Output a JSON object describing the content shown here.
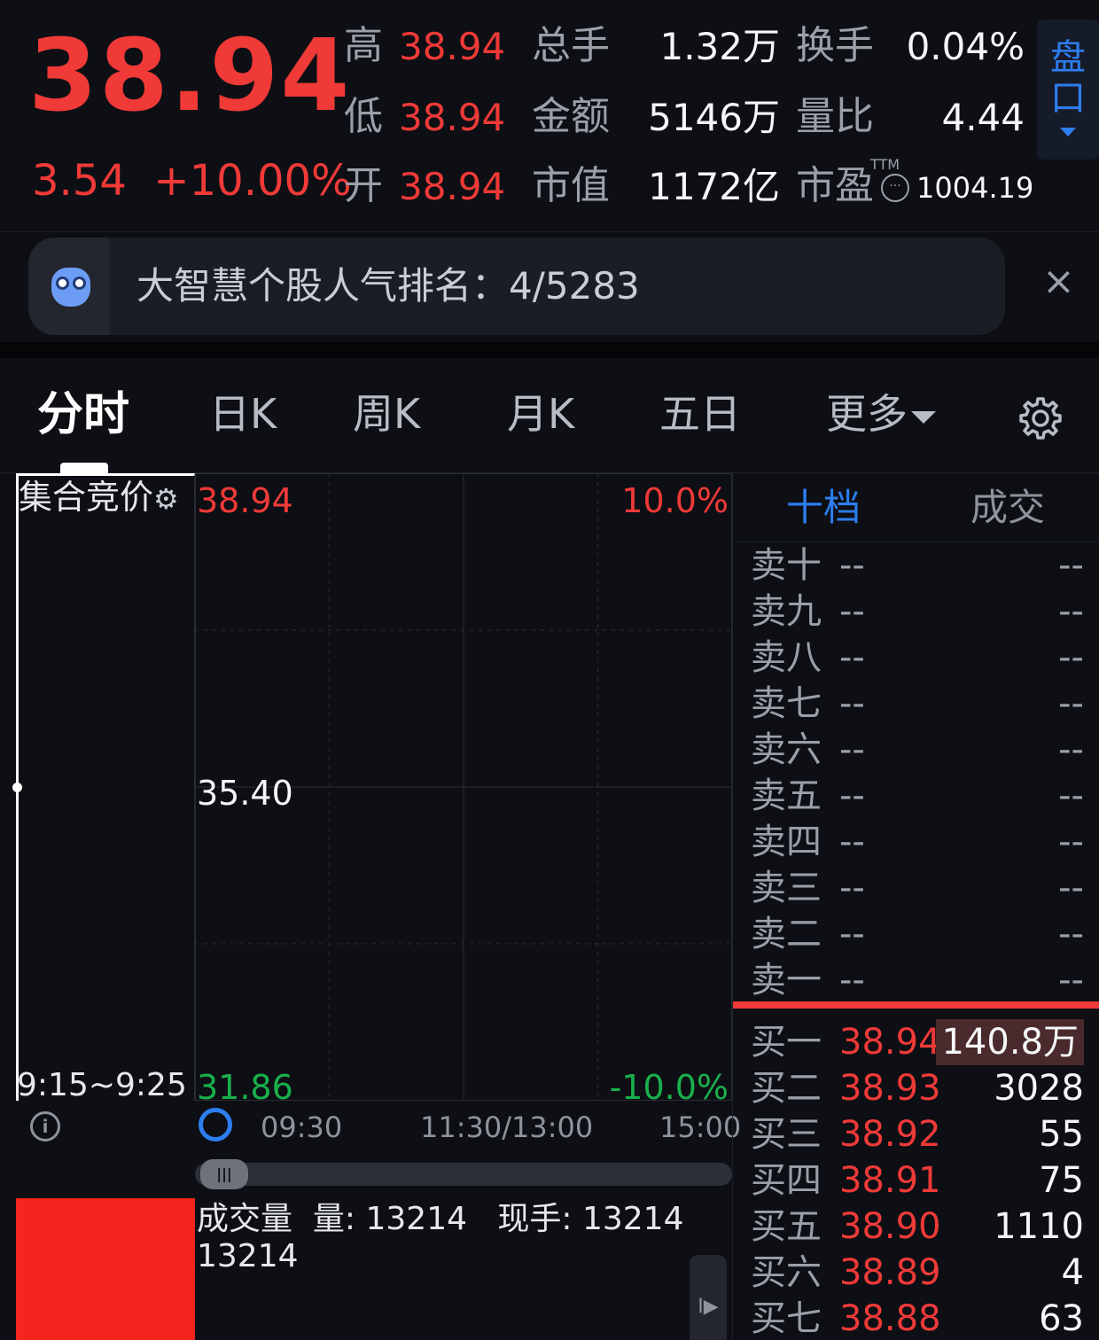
{
  "quote": {
    "price": "38.94",
    "change": "3.54",
    "change_pct": "+10.00%",
    "high_label": "高",
    "high_value": "38.94",
    "low_label": "低",
    "low_value": "38.94",
    "open_label": "开",
    "open_value": "38.94",
    "volume_label": "总手",
    "volume_value": "1.32万",
    "amount_label": "金额",
    "amount_value": "5146万",
    "mktcap_label": "市值",
    "mktcap_value": "1172亿",
    "turnover_label": "换手",
    "turnover_value": "0.04%",
    "volratio_label": "量比",
    "volratio_value": "4.44",
    "pe_label": "市盈",
    "pe_tag": "TTM",
    "pe_value": "1004.19",
    "pankou_label": "盘口"
  },
  "banner": {
    "text": "大智慧个股人气排名：4/5283",
    "close_symbol": "×"
  },
  "tabs": {
    "items": [
      "分时",
      "日K",
      "周K",
      "月K",
      "五日",
      "更多"
    ],
    "active": "分时"
  },
  "auction": {
    "label": "集合竞价",
    "time": "9:15~9:25"
  },
  "chart": {
    "price_top": "38.94",
    "price_mid": "35.40",
    "price_bottom": "31.86",
    "pct_top": "10.0%",
    "pct_bottom": "-10.0%",
    "time_labels": [
      "09:30",
      "11:30/13:00",
      "15:00"
    ],
    "colors": {
      "up": "#f03a38",
      "down": "#19b04b",
      "grid": "#2a2d35"
    }
  },
  "chart_data": {
    "type": "line",
    "x": [],
    "series": [],
    "ylim": [
      31.86,
      38.94
    ],
    "grid": true
  },
  "volume": {
    "title": "成交量",
    "vol_label": "量:",
    "vol_value": "13214",
    "now_label": "现手:",
    "now_value": "13214",
    "value": "13214"
  },
  "book": {
    "tab_active": "十档",
    "tab_other": "成交",
    "asks": [
      {
        "label": "卖十",
        "price": "--",
        "vol": "--"
      },
      {
        "label": "卖九",
        "price": "--",
        "vol": "--"
      },
      {
        "label": "卖八",
        "price": "--",
        "vol": "--"
      },
      {
        "label": "卖七",
        "price": "--",
        "vol": "--"
      },
      {
        "label": "卖六",
        "price": "--",
        "vol": "--"
      },
      {
        "label": "卖五",
        "price": "--",
        "vol": "--"
      },
      {
        "label": "卖四",
        "price": "--",
        "vol": "--"
      },
      {
        "label": "卖三",
        "price": "--",
        "vol": "--"
      },
      {
        "label": "卖二",
        "price": "--",
        "vol": "--"
      },
      {
        "label": "卖一",
        "price": "--",
        "vol": "--"
      }
    ],
    "bids": [
      {
        "label": "买一",
        "price": "38.94",
        "vol": "140.8万"
      },
      {
        "label": "买二",
        "price": "38.93",
        "vol": "3028"
      },
      {
        "label": "买三",
        "price": "38.92",
        "vol": "55"
      },
      {
        "label": "买四",
        "price": "38.91",
        "vol": "75"
      },
      {
        "label": "买五",
        "price": "38.90",
        "vol": "1110"
      },
      {
        "label": "买六",
        "price": "38.89",
        "vol": "4"
      },
      {
        "label": "买七",
        "price": "38.88",
        "vol": "63"
      }
    ]
  }
}
